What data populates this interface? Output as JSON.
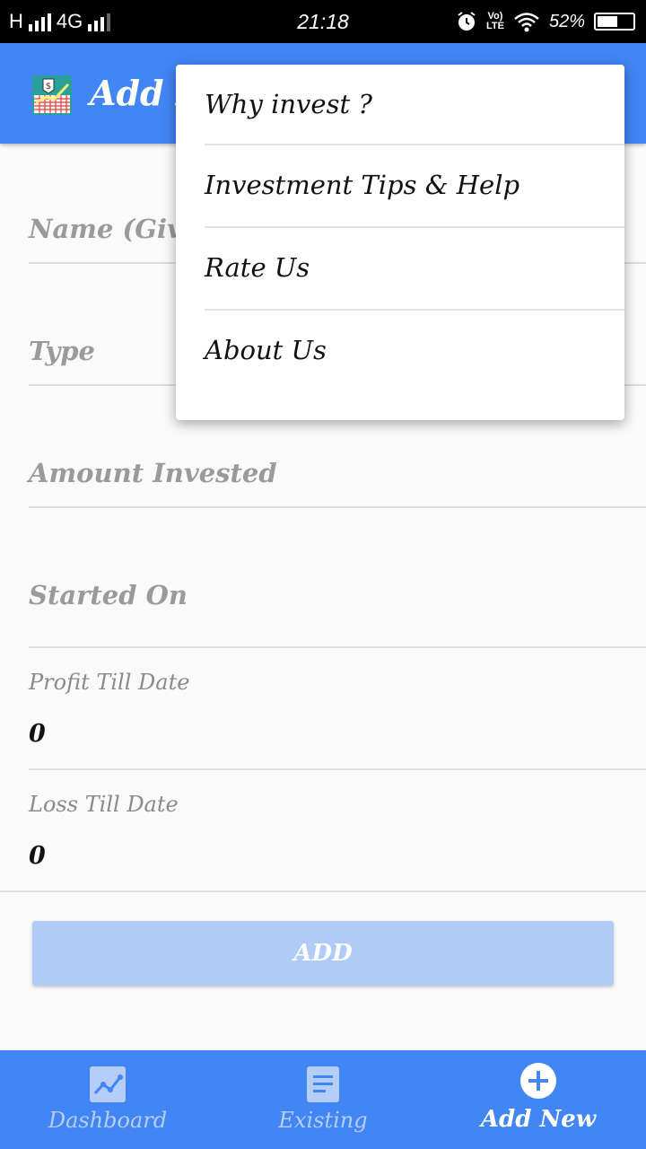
{
  "status_bar": {
    "network_left": "H",
    "network_type": "4G",
    "time": "21:18",
    "volte_top": "Vo)",
    "volte_bottom": "LTE",
    "battery": "52%",
    "icons": [
      "signal-icon",
      "alarm-icon",
      "volte-icon",
      "wifi-icon",
      "battery-icon"
    ]
  },
  "app_bar": {
    "title": "Add New",
    "logo": "investment-chart-logo"
  },
  "form": {
    "name_placeholder": "Name (Given",
    "type_placeholder": "Type",
    "amount_placeholder": "Amount Invested",
    "started_placeholder": "Started On",
    "profit_label": "Profit Till Date",
    "profit_value": "0",
    "loss_label": "Loss Till Date",
    "loss_value": "0"
  },
  "add_button": {
    "label": "ADD"
  },
  "bottom_nav": {
    "items": [
      {
        "label": "Dashboard",
        "icon": "chart-icon",
        "active": false
      },
      {
        "label": "Existing",
        "icon": "document-icon",
        "active": false
      },
      {
        "label": "Add New",
        "icon": "add-circle-icon",
        "active": true
      }
    ]
  },
  "overflow_menu": {
    "items": [
      {
        "label": "Why invest ?"
      },
      {
        "label": "Investment Tips & Help"
      },
      {
        "label": "Rate Us"
      },
      {
        "label": "About Us"
      }
    ]
  },
  "colors": {
    "primary": "#4285f4",
    "button_disabled": "#b1cbf8",
    "nav_inactive": "#b5cdf9",
    "background": "#fafafa"
  }
}
